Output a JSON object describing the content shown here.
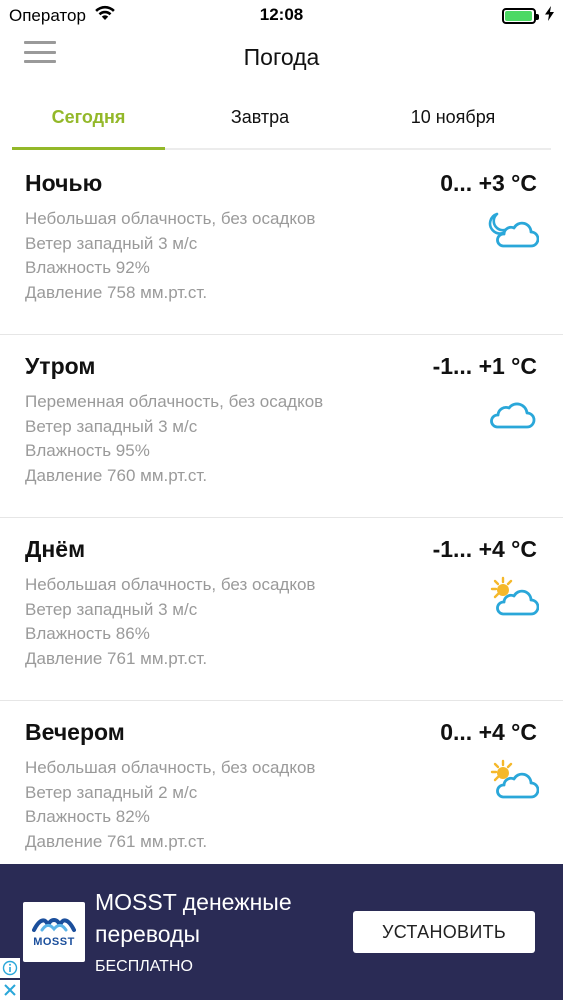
{
  "status_bar": {
    "carrier": "Оператор",
    "time": "12:08",
    "battery_level": 0.95
  },
  "header": {
    "title": "Погода"
  },
  "tabs": [
    {
      "label": "Сегодня",
      "active": true
    },
    {
      "label": "Завтра",
      "active": false
    },
    {
      "label": "10 ноября",
      "active": false
    }
  ],
  "periods": [
    {
      "name": "Ночью",
      "temp": "0... +3 °C",
      "condition": "Небольшая облачность, без осадков",
      "wind": "Ветер западный 3 м/с",
      "humidity": "Влажность 92%",
      "pressure": "Давление 758 мм.рт.ст.",
      "icon": "moon-cloud-icon"
    },
    {
      "name": "Утром",
      "temp": "-1... +1 °C",
      "condition": "Переменная облачность, без осадков",
      "wind": "Ветер западный 3 м/с",
      "humidity": "Влажность 95%",
      "pressure": "Давление 760 мм.рт.ст.",
      "icon": "cloud-icon"
    },
    {
      "name": "Днём",
      "temp": "-1... +4 °C",
      "condition": "Небольшая облачность, без осадков",
      "wind": "Ветер западный 3 м/с",
      "humidity": "Влажность 86%",
      "pressure": "Давление 761 мм.рт.ст.",
      "icon": "sun-cloud-icon"
    },
    {
      "name": "Вечером",
      "temp": "0... +4 °C",
      "condition": "Небольшая облачность, без осадков",
      "wind": "Ветер западный 2 м/с",
      "humidity": "Влажность 82%",
      "pressure": "Давление 761 мм.рт.ст.",
      "icon": "sun-cloud-icon"
    }
  ],
  "ad": {
    "logo_text": "MOSST",
    "title": "MOSST денежные переводы",
    "subtitle": "БЕСПЛАТНО",
    "install_label": "УСТАНОВИТЬ"
  },
  "colors": {
    "accent": "#93b829",
    "icon_blue": "#2aa7d9",
    "sun_yellow": "#f5b82a",
    "ad_background": "#2a2b55"
  }
}
